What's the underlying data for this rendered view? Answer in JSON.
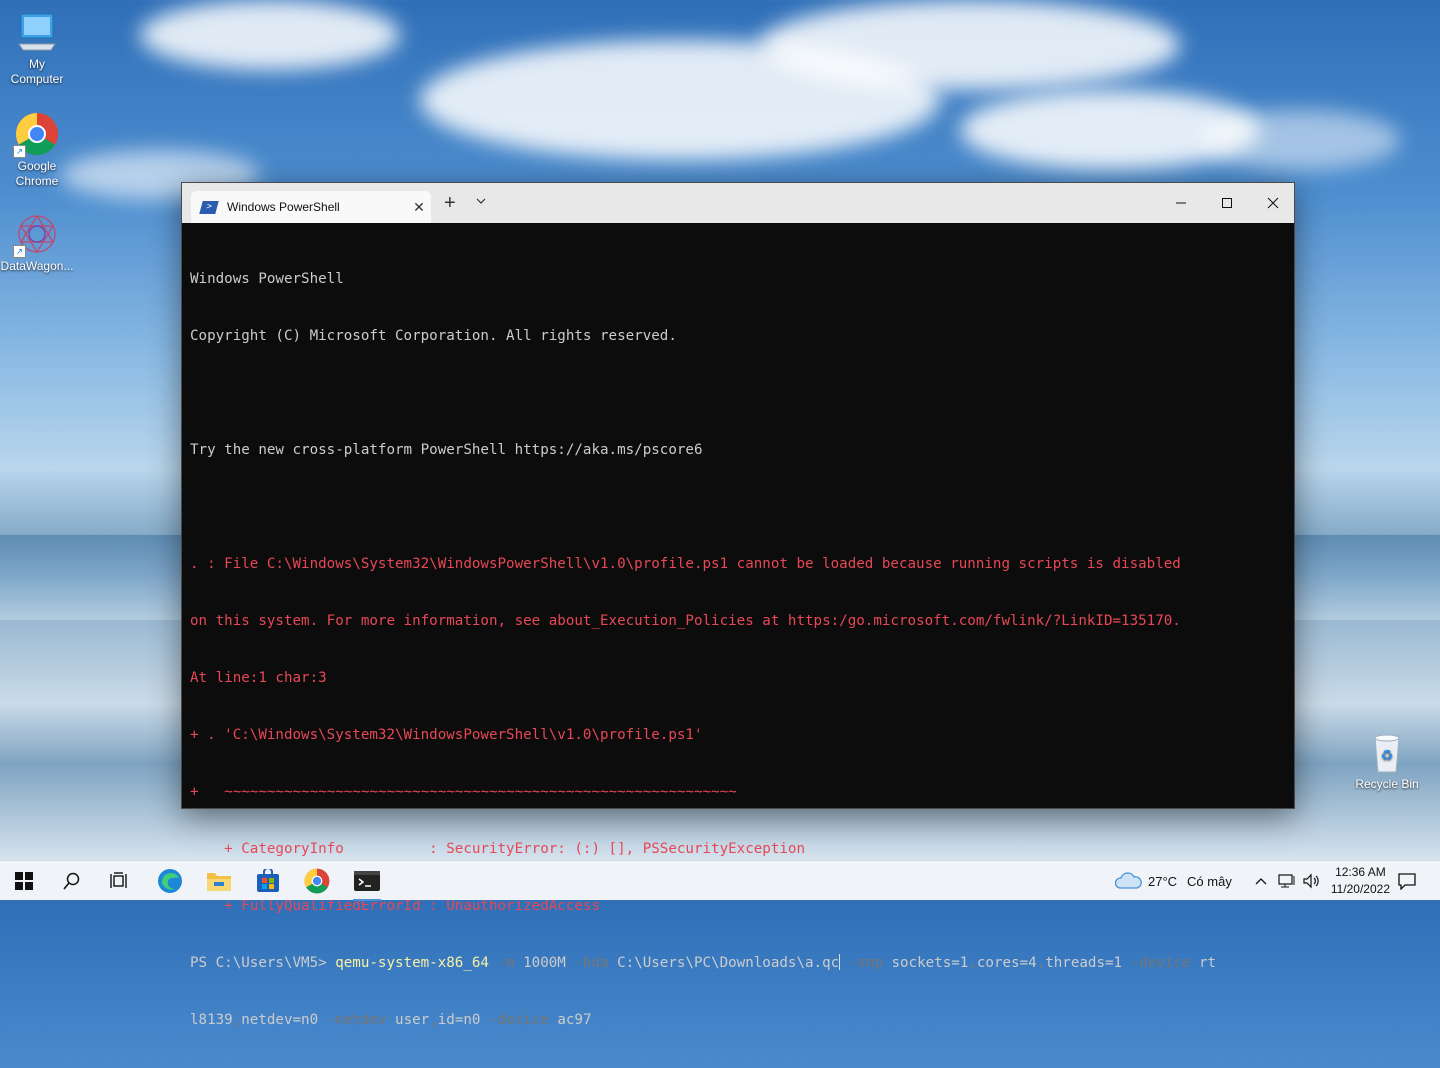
{
  "desktop": {
    "icons": [
      {
        "label_line1": "My",
        "label_line2": "Computer",
        "icon": "computer-icon"
      },
      {
        "label_line1": "Google",
        "label_line2": "Chrome",
        "icon": "chrome-icon"
      },
      {
        "label_line1": "DataWagon...",
        "label_line2": "",
        "icon": "datawagon-icon"
      },
      {
        "label_line1": "Recycle Bin",
        "label_line2": "",
        "icon": "recycle-bin-icon"
      }
    ]
  },
  "window": {
    "tab_title": "Windows PowerShell",
    "new_tab_symbol": "+",
    "dropdown_symbol": "⌄",
    "controls": {
      "minimize": "—",
      "maximize": "☐",
      "close": "✕"
    }
  },
  "terminal": {
    "header1": "Windows PowerShell",
    "header2": "Copyright (C) Microsoft Corporation. All rights reserved.",
    "tip": "Try the new cross-platform PowerShell https://aka.ms/pscore6",
    "error_lines": [
      ". : File C:\\Windows\\System32\\WindowsPowerShell\\v1.0\\profile.ps1 cannot be loaded because running scripts is disabled",
      "on this system. For more information, see about_Execution_Policies at https:/go.microsoft.com/fwlink/?LinkID=135170.",
      "At line:1 char:3",
      "+ . 'C:\\Windows\\System32\\WindowsPowerShell\\v1.0\\profile.ps1'",
      "+   ~~~~~~~~~~~~~~~~~~~~~~~~~~~~~~~~~~~~~~~~~~~~~~~~~~~~~~~~~~~~",
      "    + CategoryInfo          : SecurityError: (:) [], PSSecurityException",
      "    + FullyQualifiedErrorId : UnauthorizedAccess"
    ],
    "prompt": "PS C:\\Users\\VM5> ",
    "command": {
      "exe": "qemu-system-x86_64",
      "p1": " -m",
      "v1": " 1000M",
      "p2": " -hda",
      "v2": " C:\\Users\\PC\\Downloads\\a.qc",
      "p3": " -smp",
      "v3a": " sockets=1",
      "c1": ",",
      "v3b": "cores=4",
      "c2": ",",
      "v3c": "threads=1",
      "p4": " -device",
      "v4": " rt",
      "line2a": "l8139",
      "c3": ",",
      "line2b": "netdev=n0",
      "p5": " -netdev",
      "v5a": " user",
      "c4": ",",
      "v5b": "id=n0",
      "p6": " -device",
      "v6": " ac97"
    }
  },
  "taskbar": {
    "weather_temp": "27°C",
    "weather_text": "Có mây",
    "time": "12:36 AM",
    "date": "11/20/2022"
  }
}
